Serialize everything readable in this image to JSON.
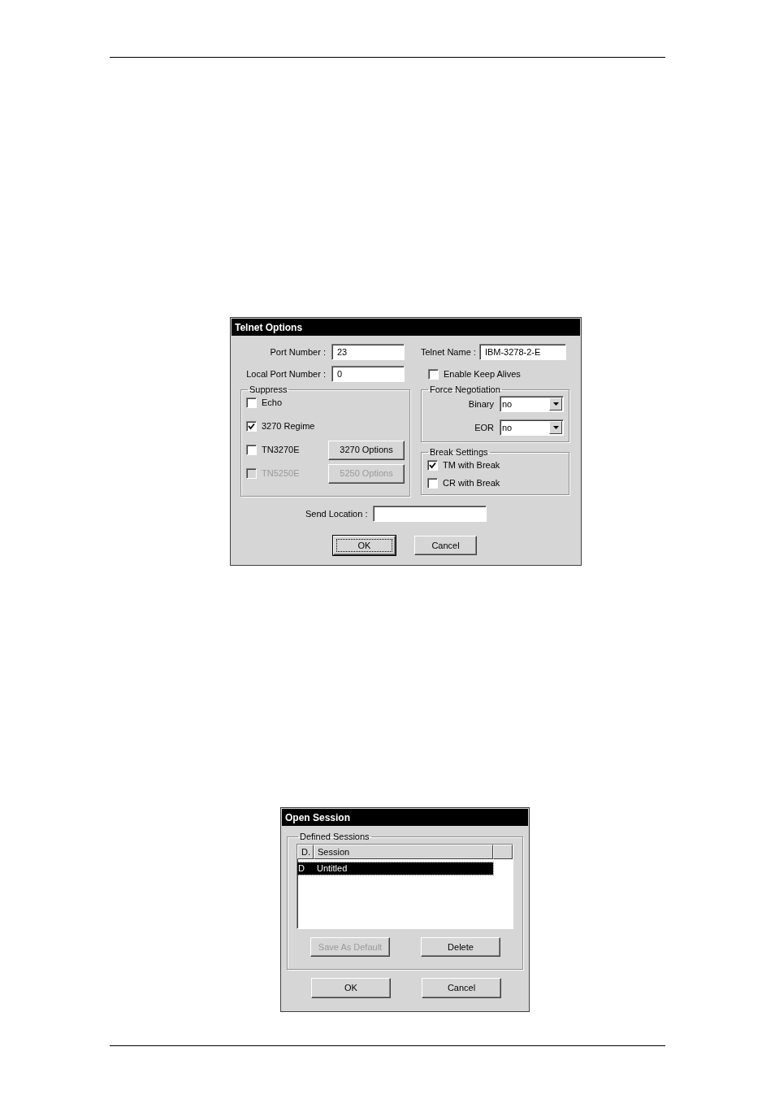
{
  "telnet_options": {
    "title": "Telnet Options",
    "fields": [
      {
        "label": "Port Number :",
        "value": "23"
      },
      {
        "label": "Local Port Number :",
        "value": "0"
      }
    ],
    "telnet_name": {
      "label": "Telnet Name :",
      "value": "IBM-3278-2-E"
    },
    "keep_alives": {
      "label": "Enable Keep Alives",
      "checked": false
    },
    "suppress": {
      "title": "Suppress",
      "options": [
        {
          "label": "Echo",
          "checked": false,
          "disabled": false
        },
        {
          "label": "3270 Regime",
          "checked": true,
          "disabled": false
        },
        {
          "label": "TN3270E",
          "checked": false,
          "disabled": false,
          "button": {
            "label": "3270 Options",
            "disabled": false
          }
        },
        {
          "label": "TN5250E",
          "checked": false,
          "disabled": true,
          "button": {
            "label": "5250 Options",
            "disabled": true
          }
        }
      ]
    },
    "force_negotiation": {
      "title": "Force Negotiation",
      "selects": [
        {
          "label": "Binary",
          "value": "no"
        },
        {
          "label": "EOR",
          "value": "no"
        }
      ]
    },
    "break_settings": {
      "title": "Break Settings",
      "options": [
        {
          "label": "TM with Break",
          "checked": true
        },
        {
          "label": "CR with Break",
          "checked": false
        }
      ]
    },
    "send_location": {
      "label": "Send Location :"
    },
    "buttons": [
      {
        "label": "OK",
        "focused": true
      },
      {
        "label": "Cancel",
        "focused": false
      }
    ]
  },
  "open_session": {
    "title": "Open Session",
    "group_title": "Defined Sessions",
    "columns": [
      "D.",
      "Session"
    ],
    "rows": [
      {
        "cells": [
          "D",
          "Untitled"
        ],
        "selected": true
      }
    ],
    "list_buttons": [
      {
        "label": "Save As Default",
        "disabled": true
      },
      {
        "label": "Delete",
        "disabled": false
      }
    ],
    "buttons": [
      {
        "label": "OK",
        "focused": false
      },
      {
        "label": "Cancel",
        "focused": false
      }
    ]
  }
}
